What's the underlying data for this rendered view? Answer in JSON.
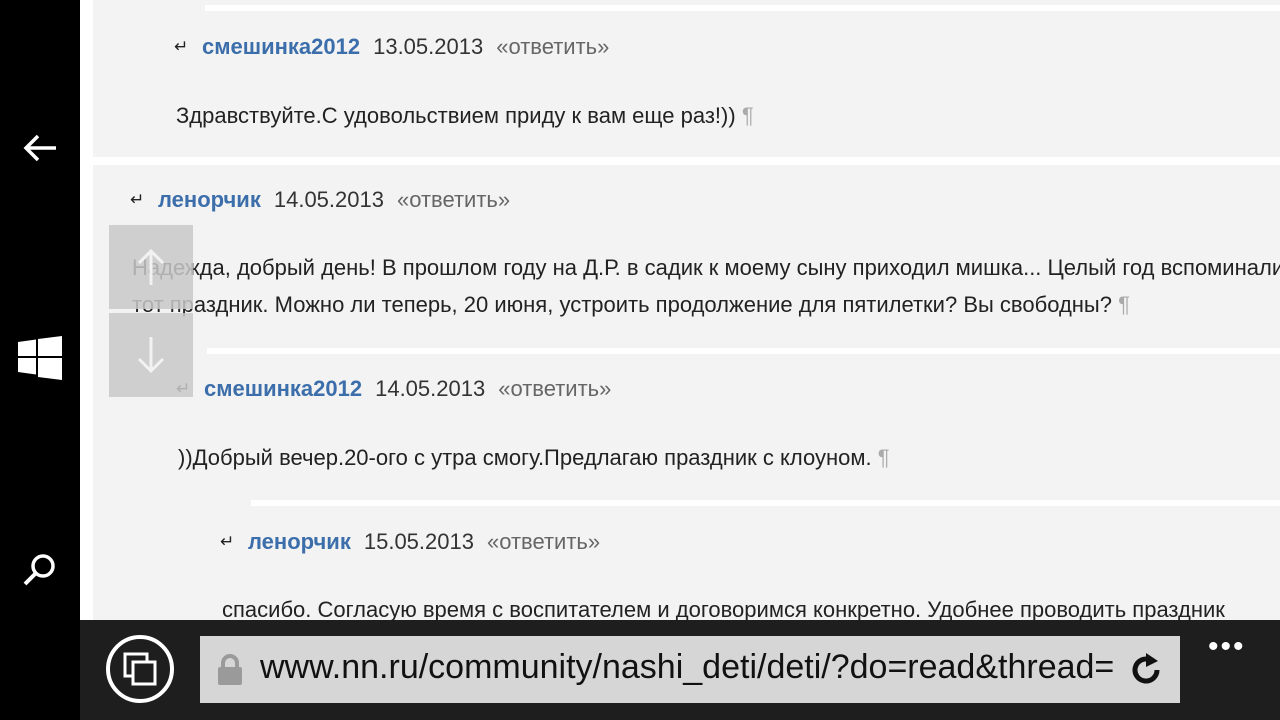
{
  "comments": [
    {
      "author": "смешинка2012",
      "date": "13.05.2013",
      "reply": "«ответить»",
      "text": "Здравствуйте.С удовольствием приду к вам еще раз!))"
    },
    {
      "author": "ленорчик",
      "date": "14.05.2013",
      "reply": "«ответить»",
      "text_line1": "Надежда, добрый день! В прошлом году на Д.Р. в садик к моему сыну приходил мишка... Целый год вспоминали",
      "text_line2": "тот праздник. Можно ли теперь, 20 июня, устроить продолжение для пятилетки? Вы свободны?"
    },
    {
      "author": "смешинка2012",
      "date": "14.05.2013",
      "reply": "«ответить»",
      "text": "))Добрый вечер.20-ого с утра смогу.Предлагаю праздник с клоуном."
    },
    {
      "author": "ленорчик",
      "date": "15.05.2013",
      "reply": "«ответить»",
      "text": "спасибо. Согласую время с воспитателем и договоримся конкретно. Удобнее проводить праздник"
    }
  ],
  "pilcrow": "¶",
  "reply_glyph": "↵",
  "browser": {
    "url": "www.nn.ru/community/nashi_deti/deti/?do=read&thread=",
    "more": "•••"
  },
  "colors": {
    "author_link": "#3b6eaa",
    "comment_bg": "#f3f3f3",
    "browser_bar": "#1e1e1e",
    "address_bg": "#d6d6d6"
  },
  "icons": [
    "back-arrow-icon",
    "windows-logo-icon",
    "search-icon",
    "scroll-up-icon",
    "scroll-down-icon",
    "tabs-icon",
    "lock-icon",
    "refresh-icon",
    "more-icon"
  ]
}
